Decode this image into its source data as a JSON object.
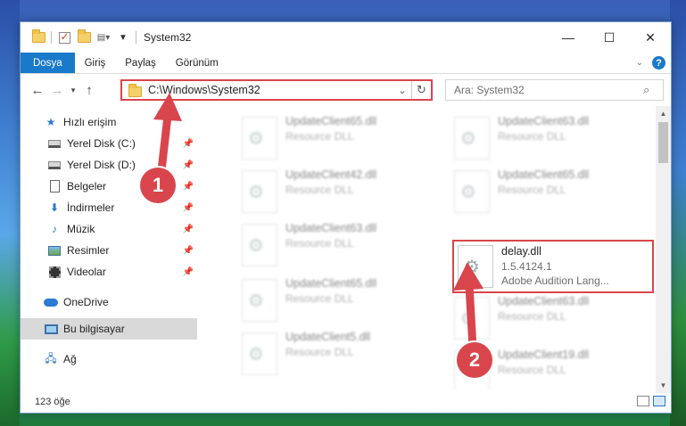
{
  "window": {
    "title": "System32",
    "controls": {
      "minimize": "—",
      "maximize": "☐",
      "close": "✕"
    }
  },
  "ribbon": {
    "tabs": [
      "Dosya",
      "Giriş",
      "Paylaş",
      "Görünüm"
    ]
  },
  "nav": {
    "address": "C:\\Windows\\System32",
    "search_placeholder": "Ara: System32"
  },
  "sidebar": {
    "quick_access": "Hızlı erişim",
    "items": [
      {
        "label": "Yerel Disk (C:)",
        "icon": "drive-icon"
      },
      {
        "label": "Yerel Disk (D:)",
        "icon": "drive-icon"
      },
      {
        "label": "Belgeler",
        "icon": "document-icon"
      },
      {
        "label": "İndirmeler",
        "icon": "download-icon"
      },
      {
        "label": "Müzik",
        "icon": "music-icon"
      },
      {
        "label": "Resimler",
        "icon": "pictures-icon"
      },
      {
        "label": "Videolar",
        "icon": "video-icon"
      }
    ],
    "onedrive": "OneDrive",
    "this_pc": "Bu bilgisayar",
    "network": "Ağ"
  },
  "files": [
    {
      "name": "UpdateClient65.dll",
      "sub": "Resource DLL"
    },
    {
      "name": "UpdateClient63.dll",
      "sub": "Resource DLL"
    },
    {
      "name": "UpdateClient42.dll",
      "sub": "Resource DLL"
    },
    {
      "name": "UpdateClient65.dll",
      "sub": "Resource DLL"
    },
    {
      "name": "UpdateClient63.dll",
      "sub": "Resource DLL"
    },
    {
      "name": "delay.dll",
      "version": "1.5.4124.1",
      "sub": "Adobe Audition Lang..."
    },
    {
      "name": "UpdateClient65.dll",
      "sub": "Resource DLL"
    },
    {
      "name": "UpdateClient63.dll",
      "sub": "Resource DLL"
    },
    {
      "name": "UpdateClient5.dll",
      "sub": "Resource DLL"
    },
    {
      "name": "UpdateClient19.dll",
      "sub": "Resource DLL"
    }
  ],
  "status": {
    "count": "123 öğe"
  },
  "annotations": {
    "step1": "1",
    "step2": "2",
    "color": "#d9454c"
  }
}
